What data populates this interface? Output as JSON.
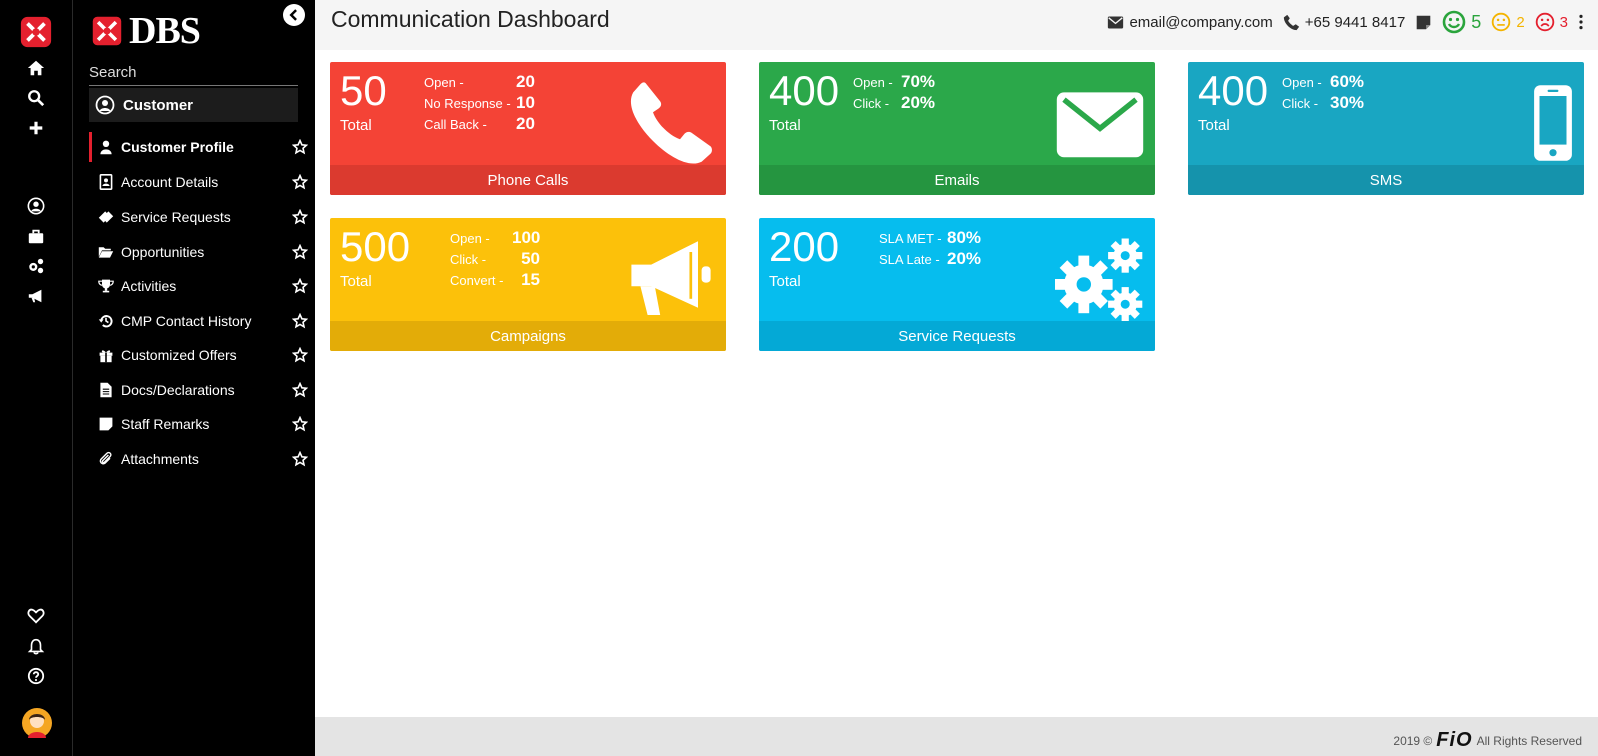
{
  "brand": {
    "name": "DBS"
  },
  "rail": {
    "icons": [
      "dbs-logo-icon",
      "home-icon",
      "search-icon",
      "plus-icon",
      "user-circle-icon",
      "briefcase-icon",
      "gears-icon",
      "megaphone-icon",
      "heart-icon",
      "bell-icon",
      "help-icon",
      "avatar"
    ]
  },
  "menu": {
    "search_label": "Search",
    "section": "Customer",
    "items": [
      {
        "label": "Customer Profile",
        "icon": "user-icon",
        "active": true
      },
      {
        "label": "Account Details",
        "icon": "contact-card-icon"
      },
      {
        "label": "Service Requests",
        "icon": "ticket-icon"
      },
      {
        "label": "Opportunities",
        "icon": "folder-open-icon"
      },
      {
        "label": "Activities",
        "icon": "trophy-icon"
      },
      {
        "label": "CMP Contact History",
        "icon": "history-icon"
      },
      {
        "label": "Customized Offers",
        "icon": "gift-icon"
      },
      {
        "label": "Docs/Declarations",
        "icon": "document-icon"
      },
      {
        "label": "Staff Remarks",
        "icon": "note-icon"
      },
      {
        "label": "Attachments",
        "icon": "paperclip-icon"
      }
    ]
  },
  "header": {
    "title": "Communication Dashboard",
    "email": "email@company.com",
    "phone": "+65 9441 8417",
    "happy_count": "5",
    "neutral_count": "2",
    "sad_count": "3"
  },
  "cards": {
    "phone": {
      "value": "50",
      "total_label": "Total",
      "footer": "Phone Calls",
      "color": "#f44336",
      "footer_color": "#db3a2f",
      "stats": [
        {
          "label": "Open -",
          "value": "20"
        },
        {
          "label": "No Response -",
          "value": "10"
        },
        {
          "label": "Call Back -",
          "value": "20"
        }
      ]
    },
    "email": {
      "value": "400",
      "total_label": "Total",
      "footer": "Emails",
      "color": "#2ba84a",
      "footer_color": "#259540",
      "stats": [
        {
          "label": "Open -",
          "value": "70%"
        },
        {
          "label": "Click -",
          "value": "20%"
        }
      ]
    },
    "sms": {
      "value": "400",
      "total_label": "Total",
      "footer": "SMS",
      "color": "#19a6c2",
      "footer_color": "#1593ac",
      "stats": [
        {
          "label": "Open -",
          "value": "60%"
        },
        {
          "label": "Click -",
          "value": "30%"
        }
      ]
    },
    "campaigns": {
      "value": "500",
      "total_label": "Total",
      "footer": "Campaigns",
      "color": "#fcc10a",
      "footer_color": "#e3ac08",
      "stats": [
        {
          "label": "Open -",
          "value": "100"
        },
        {
          "label": "Click -",
          "value": "50"
        },
        {
          "label": "Convert -",
          "value": "15"
        }
      ]
    },
    "service": {
      "value": "200",
      "total_label": "Total",
      "footer": "Service Requests",
      "color": "#06bdee",
      "footer_color": "#04a9d6",
      "stats": [
        {
          "label": "SLA MET -",
          "value": "80%"
        },
        {
          "label": "SLA Late -",
          "value": "20%"
        }
      ]
    }
  },
  "footer": {
    "copyright": "2019 ©",
    "logo": "FiO",
    "rights": "All Rights Reserved"
  }
}
